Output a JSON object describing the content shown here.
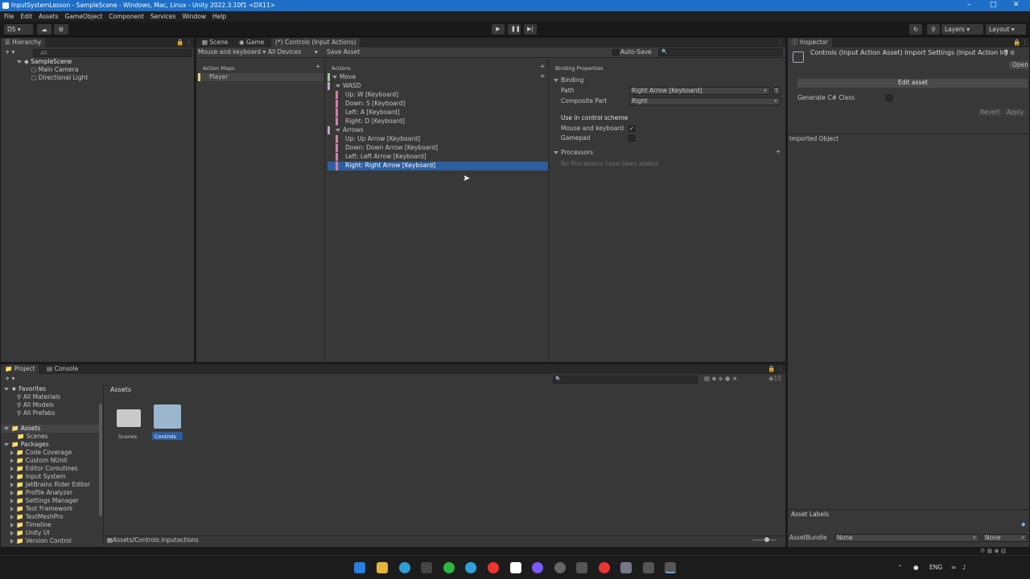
{
  "window": {
    "title": "InputSystemLesson - SampleScene - Windows, Mac, Linux - Unity 2022.3.10f1 <DX11>"
  },
  "menu": [
    "File",
    "Edit",
    "Assets",
    "GameObject",
    "Component",
    "Services",
    "Window",
    "Help"
  ],
  "toolbar": {
    "account": "DS",
    "layers": "Layers",
    "layout": "Layout"
  },
  "hierarchy": {
    "tab": "Hierarchy",
    "search_placeholder": "All",
    "scene": "SampleScene",
    "items": [
      "Main Camera",
      "Directional Light"
    ]
  },
  "center_tabs": [
    "Scene",
    "Game",
    "(*) Controls (Input Actions)"
  ],
  "editor_toolbar": {
    "scheme": "Mouse and keyboard",
    "devices": "All Devices",
    "save": "Save Asset",
    "autosave": "Auto-Save"
  },
  "action_maps": {
    "header": "Action Maps",
    "items": [
      "Player"
    ]
  },
  "actions": {
    "header": "Actions",
    "action": "Move",
    "groups": [
      {
        "name": "WASD",
        "items": [
          "Up: W [Keyboard]",
          "Down: S [Keyboard]",
          "Left: A [Keyboard]",
          "Right: D [Keyboard]"
        ]
      },
      {
        "name": "Arrows",
        "items": [
          "Up: Up Arrow [Keyboard]",
          "Down: Down Arrow [Keyboard]",
          "Left: Left Arrow [Keyboard]",
          "Right: Right Arrow [Keyboard]"
        ]
      }
    ]
  },
  "binding_props": {
    "header": "Binding Properties",
    "section": "Binding",
    "path_label": "Path",
    "path_value": "Right Arrow [Keyboard]",
    "path_t": "T",
    "composite_label": "Composite Part",
    "composite_value": "Right",
    "scheme_header": "Use in control scheme",
    "schemes": [
      {
        "name": "Mouse and keyboard",
        "checked": true
      },
      {
        "name": "Gamepad",
        "checked": false
      }
    ],
    "processors": "Processors",
    "no_processors": "No Processors have been added."
  },
  "inspector": {
    "tab": "Inspector",
    "title": "Controls (Input Action Asset) Import Settings (Input Action Im",
    "open": "Open",
    "edit": "Edit asset",
    "gen": "Generate C# Class",
    "revert": "Revert",
    "apply": "Apply",
    "imported": "Imported Object",
    "labels": "Asset Labels",
    "bundle_label": "AssetBundle",
    "bundle_value": "None",
    "variant_value": "None"
  },
  "project": {
    "tabs": [
      "Project",
      "Console"
    ],
    "favorites": "Favorites",
    "fav_items": [
      "All Materials",
      "All Models",
      "All Prefabs"
    ],
    "assets": "Assets",
    "asset_items": [
      "Scenes"
    ],
    "packages": "Packages",
    "package_items": [
      "Code Coverage",
      "Custom NUnit",
      "Editor Coroutines",
      "Input System",
      "JetBrains Rider Editor",
      "Profile Analyzer",
      "Settings Manager",
      "Test Framework",
      "TextMeshPro",
      "Timeline",
      "Unity UI",
      "Version Control"
    ],
    "breadcrumb": "Assets",
    "files": [
      "Scenes",
      "Controls"
    ],
    "path": "Assets/Controls.inputactions",
    "hidden_count": "15"
  },
  "taskbar": {
    "lang": "ENG"
  }
}
